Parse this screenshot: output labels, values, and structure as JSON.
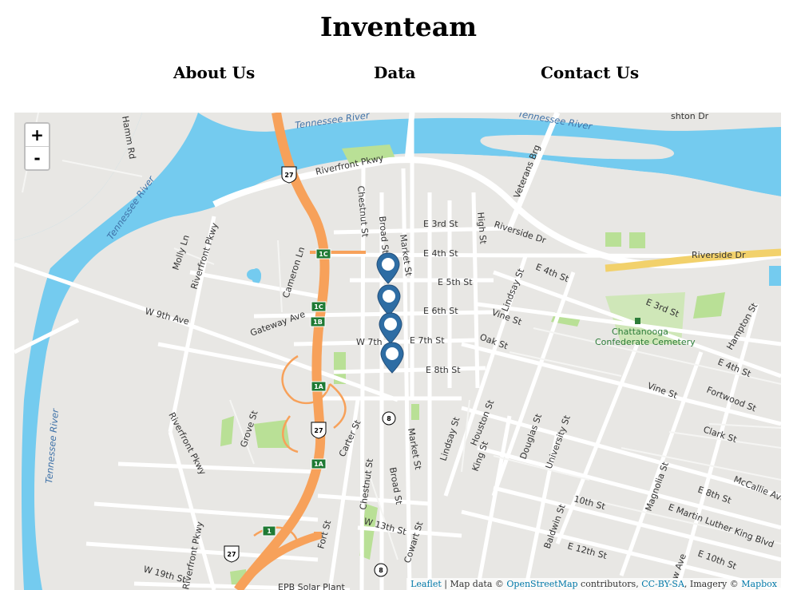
{
  "header": {
    "title": "Inventeam",
    "nav": [
      {
        "label": "About Us"
      },
      {
        "label": "Data"
      },
      {
        "label": "Contact Us"
      }
    ]
  },
  "map": {
    "zoom_in_label": "+",
    "zoom_out_label": "-",
    "attribution": {
      "leaflet": "Leaflet",
      "sep": " | Map data © ",
      "osm": "OpenStreetMap",
      "contrib": " contributors, ",
      "license": "CC-BY-SA",
      "imagery": ", Imagery © ",
      "provider": "Mapbox"
    },
    "colors": {
      "water": "#74cbef",
      "land": "#e8e7e4",
      "road": "#ffffff",
      "highway": "#f7a15a",
      "park": "#b9e096",
      "marker": "#2e6da4",
      "arterial": "#f2d16b"
    },
    "markers": [
      {
        "icon": "map-marker-icon"
      },
      {
        "icon": "map-marker-icon"
      },
      {
        "icon": "map-marker-icon"
      },
      {
        "icon": "map-marker-icon"
      }
    ],
    "labels": {
      "hamm_rd": "Hamm Rd",
      "tennessee_river_top": "Tennessee River",
      "tennessee_river_top_right": "Tennessee River",
      "tennessee_river_left": "Tennessee River",
      "tennessee_river_bottom_left": "Tennessee River",
      "riverfront_pkwy_top": "Riverfront Pkwy",
      "riverfront_pkwy_left": "Riverfront Pkwy",
      "riverfront_pkwy_mid": "Riverfront Pkwy",
      "riverfront_pkwy_bottom": "Riverfront Pkwy",
      "chestnut_st": "Chestnut St",
      "chestnut_st_bottom": "Chestnut St",
      "broad_st": "Broad St",
      "broad_st_bottom": "Broad St",
      "market_st": "Market St",
      "market_st_bottom": "Market St",
      "e3rd": "E 3rd St",
      "e4th": "E 4th St",
      "e5th": "E 5th St",
      "e6th": "E 6th St",
      "w7th": "W 7th",
      "e7th": "E 7th St",
      "e8th": "E 8th St",
      "w9th": "W 9th Ave",
      "high_st": "High St",
      "riverside_dr": "Riverside Dr",
      "riverside_dr_right": "Riverside Dr",
      "veterans_brg": "Veterans Brg",
      "lindsay_st": "Lindsay St",
      "lindsay_st_bottom": "Lindsay St",
      "e4th_right": "E 4th St",
      "e3rd_right": "E 3rd St",
      "vine_st": "Vine St",
      "vine_st_right": "Vine St",
      "oak_st": "Oak St",
      "cemetery": "Chattanooga Confederate Cemetery",
      "hampton_st": "Hampton St",
      "e4th_far": "E 4th St",
      "fortwood_st": "Fortwood St",
      "clark_st": "Clark St",
      "molly_ln": "Molly Ln",
      "cameron_ln": "Cameron Ln",
      "gateway_ave": "Gateway Ave",
      "carter_st": "Carter St",
      "grove_st": "Grove St",
      "houston_st": "Houston St",
      "king_st": "King St",
      "douglas_st": "Douglas St",
      "university_st": "University St",
      "mccallie_ave": "McCallie Ave",
      "magnolia_st": "Magnolia St",
      "e8th_right": "E 8th St",
      "e10th": "10th St",
      "emlk": "E Martin Luther King Blvd",
      "baldwin_st": "Baldwin St",
      "e12th": "E 12th St",
      "e10th_right": "E 10th St",
      "w13th": "W 13th St",
      "fort_st": "Fort St",
      "cowart_st": "Cowart St",
      "w19th": "W 19th St",
      "epb": "EPB Solar Plant",
      "rd_ave": "w Ave",
      "cemetery_l1": "Chattanooga",
      "cemetery_l2": "Confederate Cemetery",
      "ashton_dr": "shton Dr"
    },
    "shields": {
      "us27_a": "27",
      "us27_b": "27",
      "us27_c": "27",
      "exit_1c_a": "1C",
      "exit_1c_b": "1C",
      "exit_1b": "1B",
      "exit_1a_a": "1A",
      "exit_1a_b": "1A",
      "exit_1": "1",
      "route8_a": "8",
      "route8_b": "8"
    }
  }
}
